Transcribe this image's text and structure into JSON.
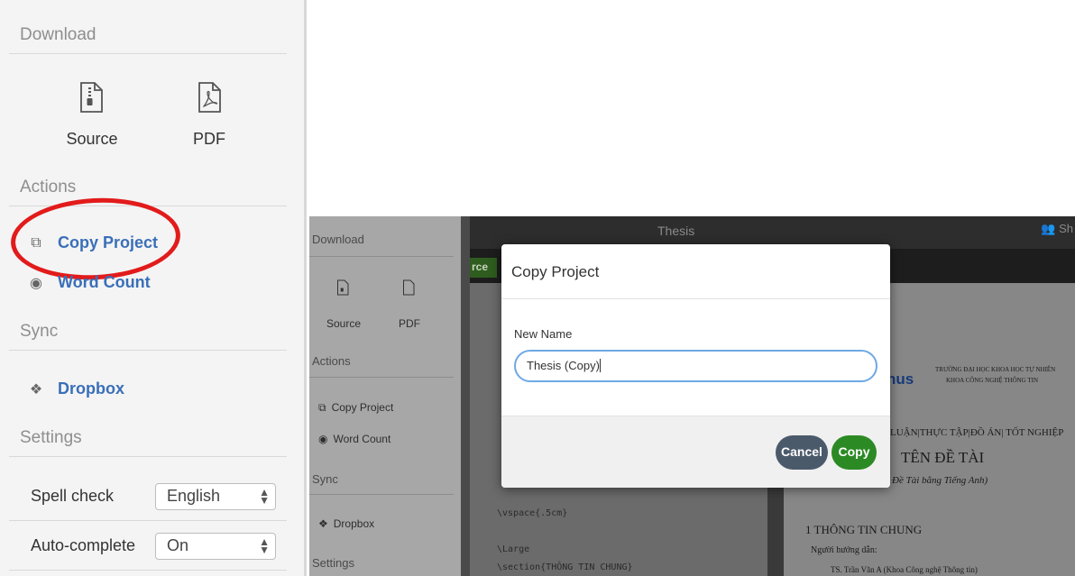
{
  "left_panel": {
    "download": {
      "title": "Download",
      "source_label": "Source",
      "pdf_label": "PDF",
      "source_icon": "archive-file-icon",
      "pdf_icon": "pdf-file-icon"
    },
    "actions": {
      "title": "Actions",
      "copy_project": "Copy Project",
      "word_count": "Word Count"
    },
    "sync": {
      "title": "Sync",
      "dropbox": "Dropbox"
    },
    "settings": {
      "title": "Settings",
      "spell_check_label": "Spell check",
      "spell_check_value": "English",
      "autocomplete_label": "Auto-complete",
      "autocomplete_value": "On"
    },
    "highlight_color": "#e21b1b"
  },
  "app": {
    "title": "Thesis",
    "share": "Sh",
    "source_tab": "rce",
    "sidebar": {
      "download": "Download",
      "source": "Source",
      "pdf": "PDF",
      "actions": "Actions",
      "copy_project": "Copy Project",
      "word_count": "Word Count",
      "sync": "Sync",
      "dropbox": "Dropbox",
      "settings": "Settings"
    },
    "code_lines": [
      "\\vspace{.5cm}",
      "\\Large",
      "\\section{THÔNG TIN CHUNG}"
    ],
    "pdf_preview": {
      "logo_fragment": "nus",
      "school_line1": "TRƯỜNG ĐẠI HỌC KHOA HỌC TỰ NHIÊN",
      "school_line2": "KHOA CÔNG NGHỆ THÔNG TIN",
      "thesis_type": "LUẬN|THỰC TẬP|ĐỒ ÁN| TỐT NGHIỆP",
      "topic": "TÊN ĐỀ TÀI",
      "topic_en": "Đề Tài bằng Tiếng Anh)",
      "section": "1   THÔNG TIN CHUNG",
      "advisor_label": "Người hướng dẫn:",
      "advisor": "TS. Trần Văn A (Khoa Công nghệ Thông tin)"
    }
  },
  "modal": {
    "title": "Copy Project",
    "field_label": "New Name",
    "field_value": "Thesis (Copy)",
    "cancel": "Cancel",
    "copy": "Copy"
  }
}
